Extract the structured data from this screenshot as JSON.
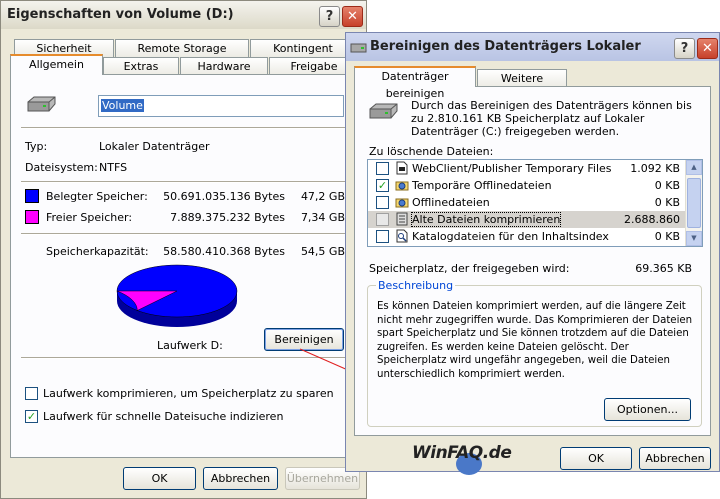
{
  "props": {
    "title": "Eigenschaften von Volume (D:)",
    "tabs_row1": [
      "Sicherheit",
      "Remote Storage",
      "Kontingent"
    ],
    "tabs_row2": [
      "Allgemein",
      "Extras",
      "Hardware",
      "Freigabe"
    ],
    "volume_name": "Volume",
    "type_label": "Typ:",
    "type_value": "Lokaler Datenträger",
    "fs_label": "Dateisystem:",
    "fs_value": "NTFS",
    "used_label": "Belegter Speicher:",
    "used_bytes": "50.691.035.136 Bytes",
    "used_gb": "47,2 GB",
    "free_label": "Freier Speicher:",
    "free_bytes": "7.889.375.232 Bytes",
    "free_gb": "7,34 GB",
    "cap_label": "Speicherkapazität:",
    "cap_bytes": "58.580.410.368 Bytes",
    "cap_gb": "54,5 GB",
    "drive_label": "Laufwerk D:",
    "cleanup_button": "Bereinigen",
    "compress_checkbox": "Laufwerk komprimieren, um Speicherplatz zu sparen",
    "compress_checked": false,
    "index_checkbox": "Laufwerk für schnelle Dateisuche indizieren",
    "index_checked": true,
    "ok": "OK",
    "cancel": "Abbrechen",
    "apply": "Übernehmen",
    "used_color": "#0000ff",
    "free_color": "#ff00ff",
    "used_fraction": 0.865
  },
  "cleanup": {
    "title": "Bereinigen des Datenträgers Lokaler Datenträg...",
    "tab_active": "Datenträger bereinigen",
    "tab_other": "Weitere Optionen",
    "intro": "Durch das Bereinigen des Datenträgers können bis zu 2.810.161 KB Speicherplatz auf Lokaler Datenträger (C:) freigegeben werden.",
    "list_label": "Zu löschende Dateien:",
    "files": [
      {
        "name": "WebClient/Publisher Temporary Files",
        "size": "1.092 KB",
        "checked": false,
        "icon": "file-icon"
      },
      {
        "name": "Temporäre Offlinedateien",
        "size": "0 KB",
        "checked": true,
        "icon": "offline-folder-icon"
      },
      {
        "name": "Offlinedateien",
        "size": "0 KB",
        "checked": false,
        "icon": "offline-folder-icon"
      },
      {
        "name": "Alte Dateien komprimieren",
        "size": "2.688.860",
        "checked": false,
        "icon": "compress-icon"
      },
      {
        "name": "Katalogdateien für den Inhaltsindex",
        "size": "0 KB",
        "checked": false,
        "icon": "search-file-icon"
      }
    ],
    "gain_label": "Speicherplatz, der freigegeben wird:",
    "gain_value": "69.365 KB",
    "desc_title": "Beschreibung",
    "desc_text": "Es können Dateien komprimiert werden, auf die längere Zeit nicht mehr zugegriffen wurde. Das Komprimieren der Dateien spart Speicherplatz und Sie können trotzdem auf die Dateien zugreifen. Es werden keine Dateien gelöscht. Der Speicherplatz wird ungefähr angegeben, weil die Dateien unterschiedlich komprimiert werden.",
    "options_button": "Optionen...",
    "ok": "OK",
    "cancel": "Abbrechen",
    "watermark": "WinFAQ.de"
  }
}
